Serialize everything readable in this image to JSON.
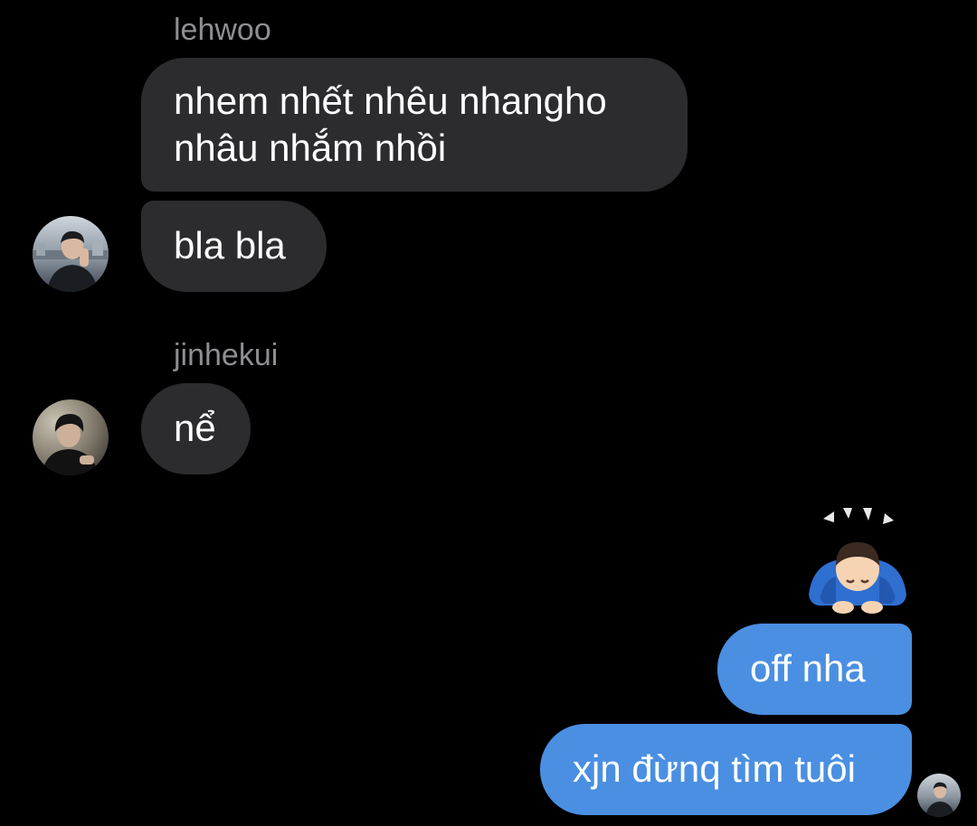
{
  "thread": {
    "groups": [
      {
        "sender": "lehwoo",
        "messages": [
          {
            "line1": "nhem nhết nhêu nhangho",
            "line2": "nhâu nhắm nhồi"
          },
          {
            "text": "bla bla"
          }
        ],
        "avatar_icon": "avatar-lehwoo-icon"
      },
      {
        "sender": "jinhekui",
        "messages": [
          {
            "text": "nể"
          }
        ],
        "avatar_icon": "avatar-jinhekui-icon"
      }
    ],
    "outgoing": {
      "emoji_icon": "person-bowing-icon",
      "messages": [
        {
          "text": "off nha"
        },
        {
          "text": "xjn đừnq tìm tuôi"
        }
      ]
    }
  },
  "colors": {
    "background": "#000000",
    "incoming_bubble": "#2c2c2e",
    "outgoing_bubble": "#4a8fe2",
    "sender_text": "#8e8e93"
  }
}
